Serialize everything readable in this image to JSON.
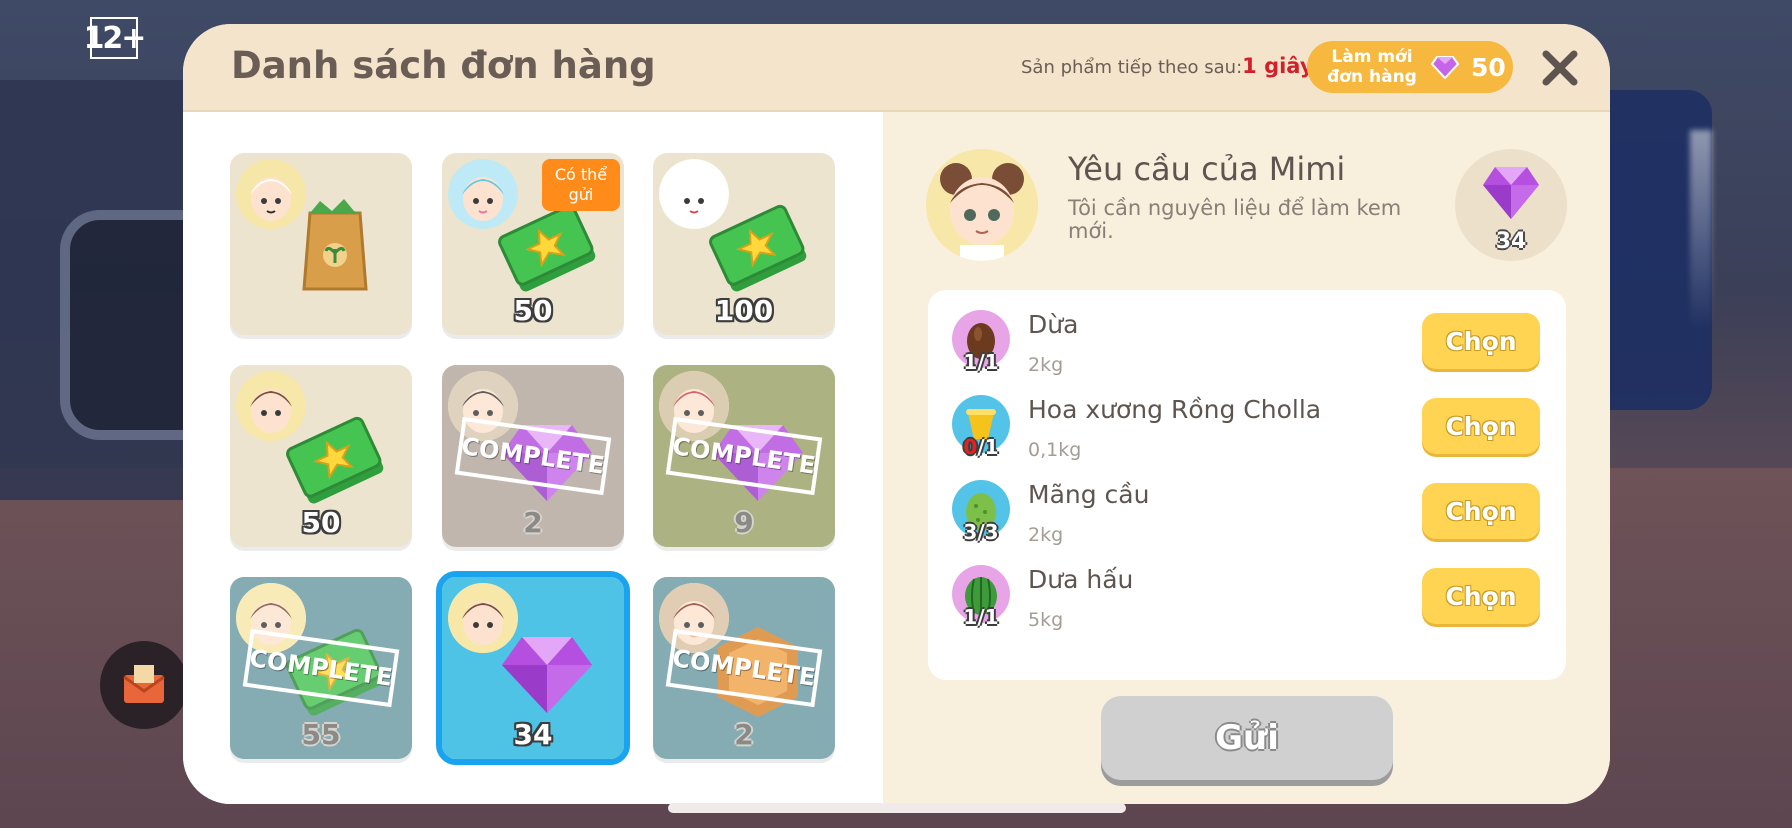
{
  "age_rating": "12+",
  "dialog": {
    "title": "Danh sách đơn hàng",
    "next_product_label": "Sản phẩm tiếp theo sau:",
    "next_product_time": "1 giây",
    "refresh_label": "Làm mới\nđơn hàng",
    "refresh_cost": "50",
    "close_icon": "close-icon"
  },
  "orders": [
    {
      "item": "seed-bag",
      "amount": "",
      "avatar": "cat-girl",
      "bg": "#ece4cf",
      "complete": false
    },
    {
      "item": "cash",
      "amount": "50",
      "avatar": "pink-hat-girl",
      "bg": "#ece4cf",
      "complete": false,
      "tag": "Có thể\ngửi"
    },
    {
      "item": "cash",
      "amount": "100",
      "avatar": "bunny",
      "bg": "#ece4cf",
      "complete": false
    },
    {
      "item": "cash",
      "amount": "50",
      "avatar": "mimi",
      "bg": "#ece4cf",
      "complete": false
    },
    {
      "item": "gem",
      "amount": "2",
      "avatar": "boy",
      "bg": "#b2a79b",
      "complete": true,
      "stamp": "COMPLETE"
    },
    {
      "item": "gem",
      "amount": "9",
      "avatar": "red-hair",
      "bg": "#9aa266",
      "complete": true,
      "stamp": "COMPLETE"
    },
    {
      "item": "cash",
      "amount": "55",
      "avatar": "mimi",
      "bg": "#6b9aa3",
      "complete": true,
      "stamp": "COMPLETE"
    },
    {
      "item": "gem",
      "amount": "34",
      "avatar": "mimi",
      "bg": "#4fc3e6",
      "complete": false,
      "selected": true
    },
    {
      "item": "coin",
      "amount": "2",
      "avatar": "monkey",
      "bg": "#6b9aa3",
      "complete": true,
      "stamp": "COMPLETE"
    }
  ],
  "request": {
    "title": "Yêu cầu của Mimi",
    "description": "Tôi cần nguyên liệu để làm kem mới.",
    "reward_amount": "34",
    "reward_icon": "gem-icon"
  },
  "ingredients": [
    {
      "name": "Dừa",
      "weight": "2kg",
      "have": "1",
      "need": "1",
      "icon": "coconut-icon",
      "icon_bg": "#e7a5e8",
      "button": "Chọn"
    },
    {
      "name": "Hoa xương Rồng Cholla",
      "weight": "0,1kg",
      "have": "0",
      "need": "1",
      "icon": "cactus-flower-icon",
      "icon_bg": "#54c3e8",
      "button": "Chọn"
    },
    {
      "name": "Mãng cầu",
      "weight": "2kg",
      "have": "3",
      "need": "3",
      "icon": "soursop-icon",
      "icon_bg": "#54c3e8",
      "button": "Chọn"
    },
    {
      "name": "Dưa hấu",
      "weight": "5kg",
      "have": "1",
      "need": "1",
      "icon": "watermelon-icon",
      "icon_bg": "#e7a5e8",
      "button": "Chọn"
    }
  ],
  "send_button": "Gửi",
  "mail_icon": "mail-icon"
}
